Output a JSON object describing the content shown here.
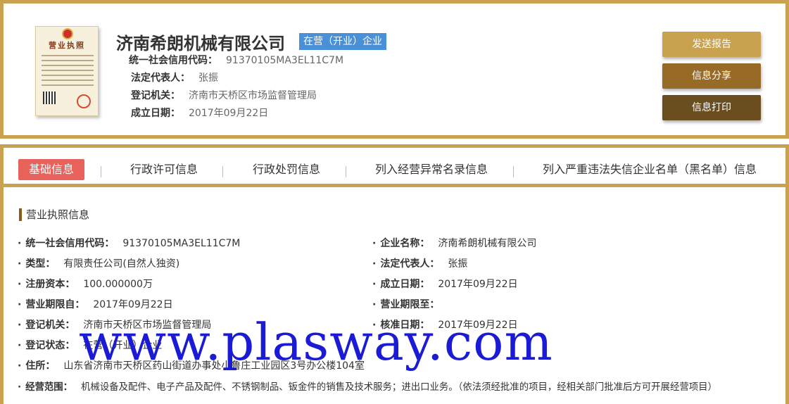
{
  "company": {
    "name": "济南希朗机械有限公司",
    "status": "在营（开业）企业",
    "license_title": "营业执照",
    "info": [
      {
        "label": "统一社会信用代码：",
        "value": "91370105MA3EL11C7M"
      },
      {
        "label": "法定代表人：",
        "value": "张振"
      },
      {
        "label": "登记机关：",
        "value": "济南市天桥区市场监督管理局"
      },
      {
        "label": "成立日期：",
        "value": "2017年09月22日"
      }
    ]
  },
  "actions": {
    "send_report": "发送报告",
    "share": "信息分享",
    "print": "信息打印"
  },
  "tabs": [
    {
      "label": "基础信息",
      "active": true
    },
    {
      "label": "行政许可信息"
    },
    {
      "label": "行政处罚信息"
    },
    {
      "label": "列入经营异常名录信息"
    },
    {
      "label": "列入严重违法失信企业名单（黑名单）信息"
    }
  ],
  "section": {
    "title": "营业执照信息"
  },
  "fields": {
    "left": [
      {
        "label": "统一社会信用代码：",
        "value": "91370105MA3EL11C7M"
      },
      {
        "label": "类型：",
        "value": "有限责任公司(自然人独资)"
      },
      {
        "label": "注册资本：",
        "value": "100.000000万"
      },
      {
        "label": "营业期限自：",
        "value": "2017年09月22日"
      },
      {
        "label": "登记机关：",
        "value": "济南市天桥区市场监督管理局"
      },
      {
        "label": "登记状态：",
        "value": "在营（开业）企业"
      }
    ],
    "right": [
      {
        "label": "企业名称：",
        "value": "济南希朗机械有限公司"
      },
      {
        "label": "法定代表人：",
        "value": "张振"
      },
      {
        "label": "成立日期：",
        "value": "2017年09月22日"
      },
      {
        "label": "营业期限至：",
        "value": ""
      },
      {
        "label": "核准日期：",
        "value": "2017年09月22日"
      }
    ],
    "address": {
      "label": "住所：",
      "value": "山东省济南市天桥区药山街道办事处小鲁庄工业园区3号办公楼104室"
    },
    "scope": {
      "label": "经营范围：",
      "value": "机械设备及配件、电子产品及配件、不锈钢制品、钣金件的销售及技术服务；进出口业务。（依法须经批准的项目，经相关部门批准后方可开展经营项目）"
    }
  },
  "watermark": "www.plasway.com"
}
